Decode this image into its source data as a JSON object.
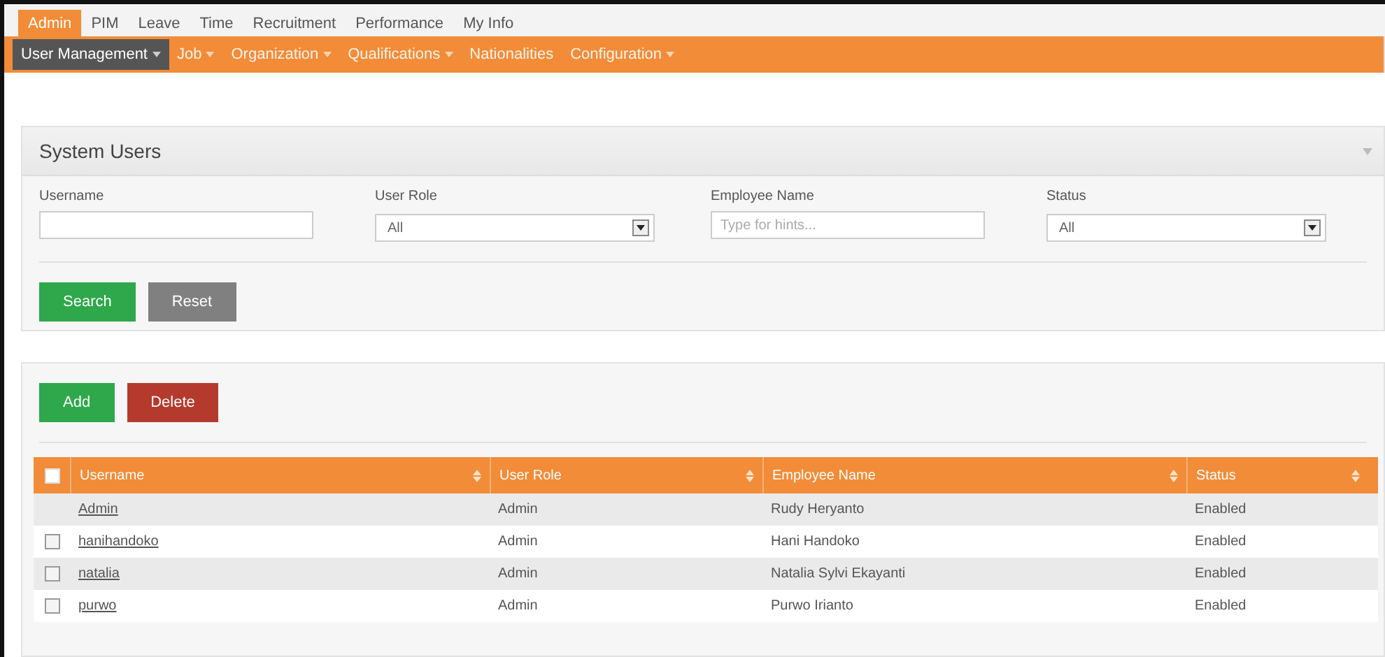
{
  "main_menu": [
    {
      "label": "Admin",
      "selected": true
    },
    {
      "label": "PIM",
      "selected": false
    },
    {
      "label": "Leave",
      "selected": false
    },
    {
      "label": "Time",
      "selected": false
    },
    {
      "label": "Recruitment",
      "selected": false
    },
    {
      "label": "Performance",
      "selected": false
    },
    {
      "label": "My Info",
      "selected": false
    }
  ],
  "sub_menu": [
    {
      "label": "User Management",
      "selected": true,
      "has_dropdown": true
    },
    {
      "label": "Job",
      "selected": false,
      "has_dropdown": true
    },
    {
      "label": "Organization",
      "selected": false,
      "has_dropdown": true
    },
    {
      "label": "Qualifications",
      "selected": false,
      "has_dropdown": true
    },
    {
      "label": "Nationalities",
      "selected": false,
      "has_dropdown": false
    },
    {
      "label": "Configuration",
      "selected": false,
      "has_dropdown": true
    }
  ],
  "filter_panel": {
    "title": "System Users",
    "fields": [
      {
        "kind": "text",
        "label": "Username"
      },
      {
        "kind": "select",
        "label": "User Role",
        "value": "All"
      },
      {
        "kind": "text",
        "label": "Employee Name",
        "placeholder": "Type for hints..."
      },
      {
        "kind": "select",
        "label": "Status",
        "value": "All"
      }
    ],
    "buttons": [
      {
        "kind": "primary",
        "label": "Search"
      },
      {
        "kind": "secondary",
        "label": "Reset"
      }
    ]
  },
  "list_panel": {
    "buttons": [
      {
        "kind": "primary",
        "label": "Add"
      },
      {
        "kind": "danger",
        "label": "Delete"
      }
    ],
    "table": {
      "select_all_checked": false,
      "columns": [
        "Username",
        "User Role",
        "Employee Name",
        "Status"
      ],
      "rows": [
        {
          "selectable": false,
          "cells": [
            "Admin",
            "Admin",
            "Rudy Heryanto",
            "Enabled"
          ]
        },
        {
          "selectable": true,
          "checked": false,
          "cells": [
            "hanihandoko",
            "Admin",
            "Hani Handoko",
            "Enabled"
          ]
        },
        {
          "selectable": true,
          "checked": false,
          "cells": [
            "natalia",
            "Admin",
            "Natalia Sylvi Ekayanti",
            "Enabled"
          ]
        },
        {
          "selectable": true,
          "checked": false,
          "cells": [
            "purwo",
            "Admin",
            "Purwo Irianto",
            "Enabled"
          ]
        }
      ]
    }
  }
}
